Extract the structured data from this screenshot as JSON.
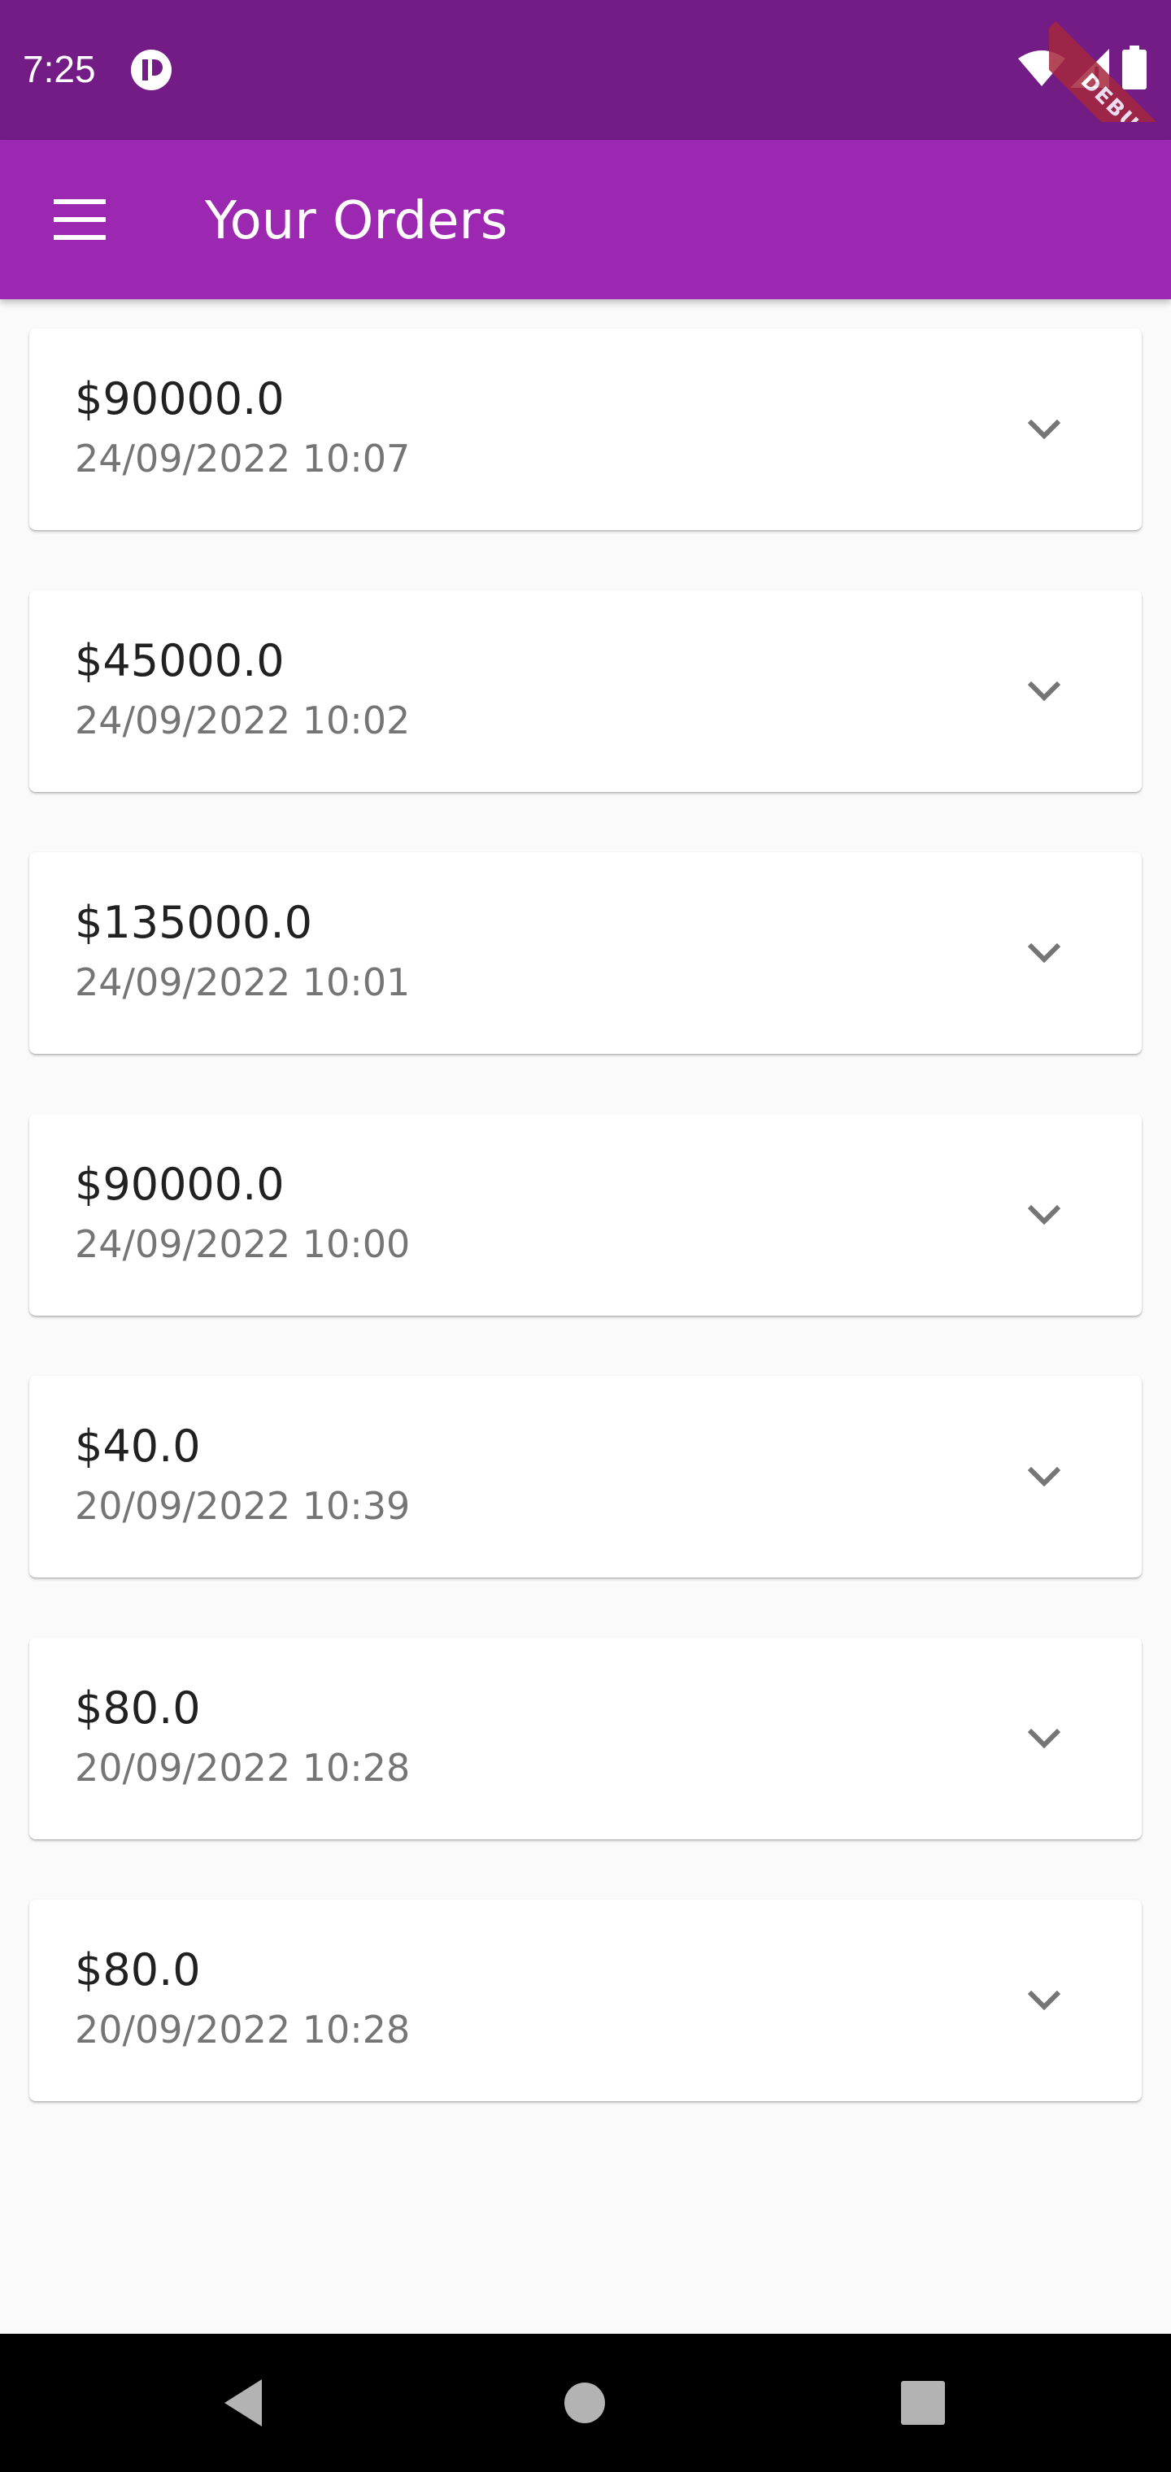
{
  "status_bar": {
    "time": "7:25",
    "icons": [
      "app-notification-icon",
      "wifi-icon",
      "signal-icon",
      "battery-icon"
    ]
  },
  "debug_banner": {
    "label": "DEBUG",
    "color": "#a5273d"
  },
  "app_bar": {
    "title": "Your Orders",
    "menu_icon": "hamburger-menu-icon",
    "color": "#9c27b0",
    "status_bar_color": "#731c86"
  },
  "orders": [
    {
      "amount": "$90000.0",
      "date": "24/09/2022 10:07"
    },
    {
      "amount": "$45000.0",
      "date": "24/09/2022 10:02"
    },
    {
      "amount": "$135000.0",
      "date": "24/09/2022 10:01"
    },
    {
      "amount": "$90000.0",
      "date": "24/09/2022 10:00"
    },
    {
      "amount": "$40.0",
      "date": "20/09/2022 10:39"
    },
    {
      "amount": "$80.0",
      "date": "20/09/2022 10:28"
    },
    {
      "amount": "$80.0",
      "date": "20/09/2022 10:28"
    }
  ],
  "nav_bar": {
    "buttons": [
      "back-icon",
      "home-icon",
      "recents-icon"
    ]
  }
}
